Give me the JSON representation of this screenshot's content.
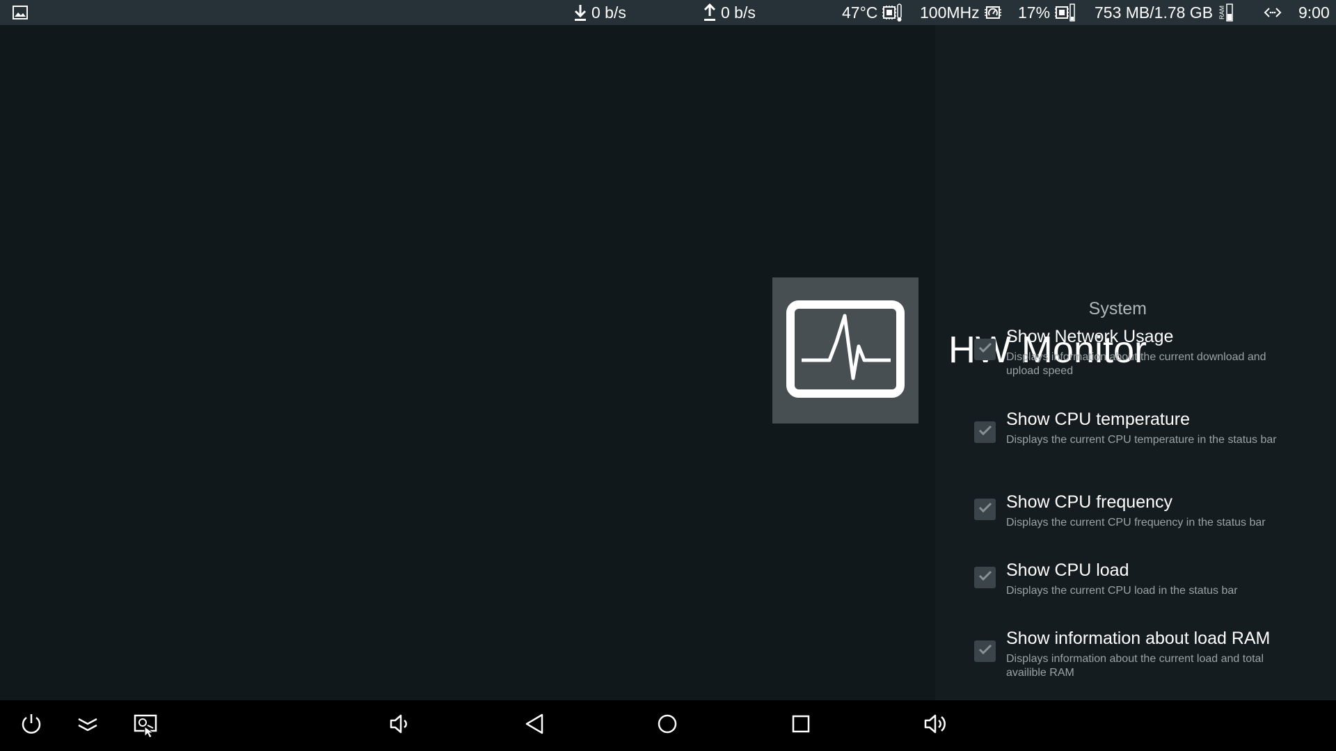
{
  "status_bar": {
    "notification_icon": "image-icon",
    "download_speed": "0 b/s",
    "upload_speed": "0 b/s",
    "cpu_temperature": "47°C",
    "cpu_frequency": "100MHz",
    "cpu_load": "17%",
    "ram_usage": "753 MB/1.78 GB",
    "ram_icon_label": "RAM",
    "clock": "9:00"
  },
  "header": {
    "breadcrumb": "System",
    "title": "HW Monitor",
    "icon": "heartbeat-monitor-icon"
  },
  "preferences": [
    {
      "title": "Show Network Usage",
      "summary": "Displays information about the current download and upload speed",
      "checked": true
    },
    {
      "title": "Show CPU temperature",
      "summary": "Displays the current CPU temperature in the status bar",
      "checked": true
    },
    {
      "title": "Show CPU frequency",
      "summary": "Displays the current CPU frequency in the status bar",
      "checked": true
    },
    {
      "title": "Show CPU load",
      "summary": "Displays the current CPU load in the status bar",
      "checked": true
    },
    {
      "title": "Show information about load RAM",
      "summary": "Displays information about the current load and total availible RAM",
      "checked": true
    }
  ],
  "nav_bar": {
    "buttons": [
      "power-icon",
      "collapse-icon",
      "screenshot-icon",
      "volume-down-icon",
      "back-icon",
      "home-icon",
      "recents-icon",
      "volume-up-icon"
    ]
  }
}
